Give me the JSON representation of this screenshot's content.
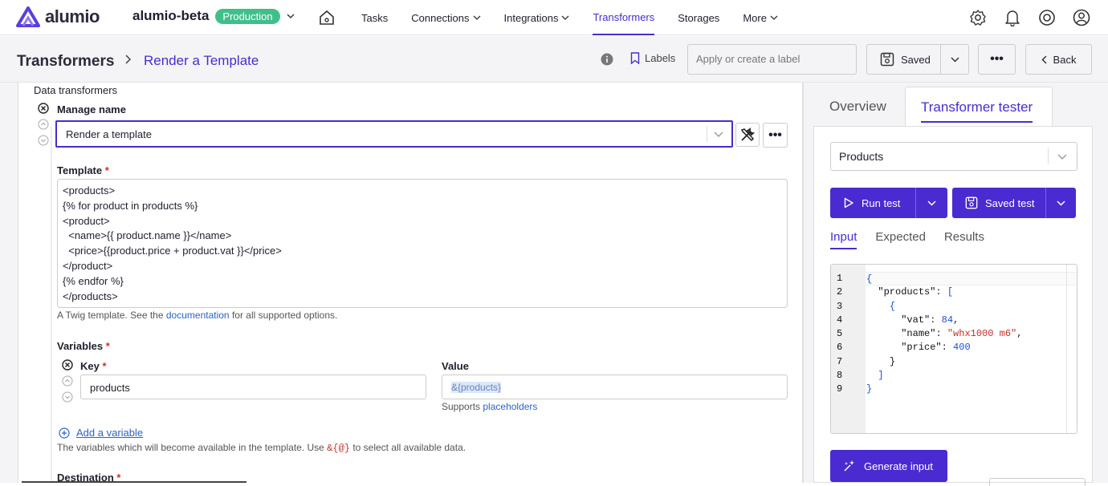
{
  "brand": {
    "name": "alumio"
  },
  "env": {
    "name": "alumio-beta",
    "badge": "Production"
  },
  "nav": {
    "items": [
      {
        "label": "Tasks"
      },
      {
        "label": "Connections"
      },
      {
        "label": "Integrations"
      },
      {
        "label": "Transformers"
      },
      {
        "label": "Storages"
      },
      {
        "label": "More"
      }
    ]
  },
  "breadcrumb": {
    "root": "Transformers",
    "current": "Render a Template"
  },
  "toolbar": {
    "labels_label": "Labels",
    "label_placeholder": "Apply or create a label",
    "saved_label": "Saved",
    "more_label": "•••",
    "back_label": "Back"
  },
  "editor": {
    "section_title": "Data transformers",
    "manage_name_label": "Manage name",
    "transformer_select": "Render a template",
    "template_label": "Template",
    "required_mark": "*",
    "template_value": "<products>\n{% for product in products %}\n<product>\n  <name>{{ product.name }}</name>\n  <price>{{product.price + product.vat }}</price>\n</product>\n{% endfor %}\n</products>",
    "template_help_pre": "A Twig template. See the ",
    "template_help_link": "documentation",
    "template_help_post": " for all supported options.",
    "variables_label": "Variables",
    "key_label": "Key",
    "value_label": "Value",
    "key_value": "products",
    "value_value": "&{products}",
    "supports_pre": "Supports ",
    "supports_link": "placeholders",
    "add_variable": "Add a variable",
    "variables_help_pre": "The variables which will become available in the template. Use ",
    "variables_help_code": "&{@}",
    "variables_help_post": " to select all available data.",
    "destination_label": "Destination"
  },
  "tester": {
    "tab_overview": "Overview",
    "tab_tester": "Transformer tester",
    "entity_select": "Products",
    "run_test": "Run test",
    "saved_test": "Saved test",
    "subtabs": [
      {
        "label": "Input"
      },
      {
        "label": "Expected"
      },
      {
        "label": "Results"
      }
    ],
    "line_numbers": [
      "1",
      "2",
      "3",
      "4",
      "5",
      "6",
      "7",
      "8",
      "9"
    ],
    "generate_input": "Generate input"
  },
  "colors": {
    "accent": "#4a2bd1",
    "badge": "#3fbf8c",
    "link": "#2d62c7",
    "required": "#d0302a"
  }
}
